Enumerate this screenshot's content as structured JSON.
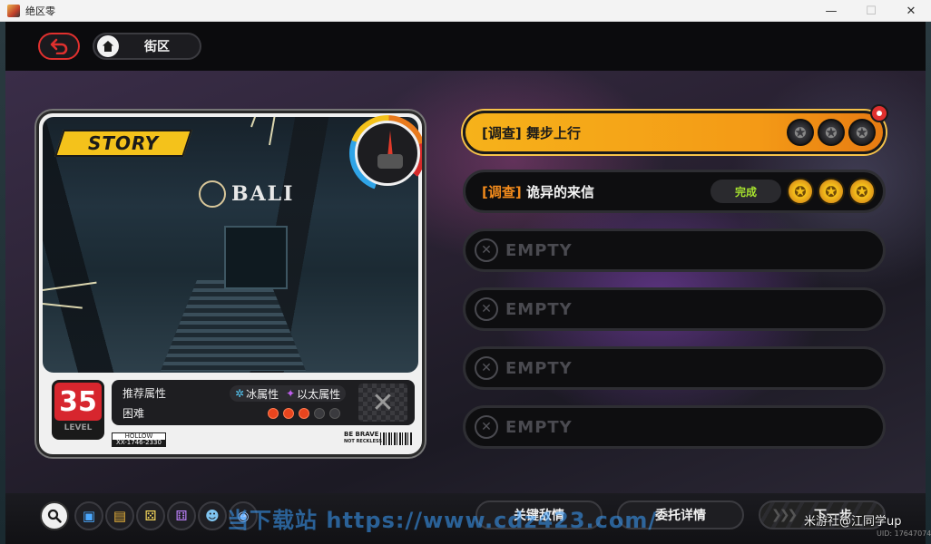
{
  "window": {
    "title": "绝区零",
    "minimize": "—",
    "maximize": "☐",
    "close": "✕"
  },
  "nav": {
    "back_icon": "undo-arrow-icon",
    "home_icon": "house-icon",
    "breadcrumb": "街区"
  },
  "card": {
    "logo_text": "STORY",
    "sign_text": "BALI",
    "level": "35",
    "level_label": "LEVEL",
    "recommended_label": "推荐属性",
    "attributes": [
      {
        "name": "冰属性",
        "icon": "ice-icon",
        "color": "#55c6f2",
        "glyph": "✲"
      },
      {
        "name": "以太属性",
        "icon": "ether-icon",
        "color": "#c05ef0",
        "glyph": "✦"
      }
    ],
    "difficulty_label": "困难",
    "difficulty_level": 3,
    "difficulty_max": 5,
    "enemy_placeholder": "✕",
    "tag_top": "HOLLOW",
    "tag_bottom": "XX-1746-2330",
    "brave_line1": "BE BRAVE",
    "brave_line2": "NOT RECKLESS"
  },
  "missions": [
    {
      "bracket_open": "[",
      "tag": "调查",
      "bracket_close": "]",
      "name": "舞步上行",
      "state": "active",
      "coins": [
        "dark",
        "dark",
        "dark"
      ],
      "pinned": true
    },
    {
      "bracket_open": "[",
      "tag": "调查",
      "bracket_close": "]",
      "name": "诡异的来信",
      "state": "complete",
      "status_label": "完成",
      "coins": [
        "gold",
        "gold",
        "gold"
      ],
      "pinned": false
    },
    {
      "state": "empty",
      "label": "EMPTY"
    },
    {
      "state": "empty",
      "label": "EMPTY"
    },
    {
      "state": "empty",
      "label": "EMPTY"
    },
    {
      "state": "empty",
      "label": "EMPTY"
    }
  ],
  "bottom": {
    "search_icon": "magnifier-icon",
    "items": [
      {
        "icon": "blue-card-icon",
        "glyph": "▣",
        "color": "#4aa8ff"
      },
      {
        "icon": "notebook-icon",
        "glyph": "▤",
        "color": "#e8b23a"
      },
      {
        "icon": "dice-icon",
        "glyph": "⚄",
        "color": "#f2d45a"
      },
      {
        "icon": "purple-dice-icon",
        "glyph": "⚅",
        "color": "#b57cf0"
      },
      {
        "icon": "bangboo-icon",
        "glyph": "☻",
        "color": "#7fc4f0"
      },
      {
        "icon": "disc-icon",
        "glyph": "◉",
        "color": "#9fc8ff"
      }
    ],
    "key_enemy_label": "关键敌情",
    "commission_label": "委托详情",
    "next_label": "下一步",
    "next_arrows": "❯❯❯"
  },
  "overlay": {
    "watermark": "当下载站 https://www.cdz423.com/",
    "source": "米游社@江同学up",
    "uid": "UID: 17647074"
  },
  "colors": {
    "accent_orange": "#f6b21a",
    "accent_red": "#e0302e",
    "complete_green": "#a6e22e"
  }
}
